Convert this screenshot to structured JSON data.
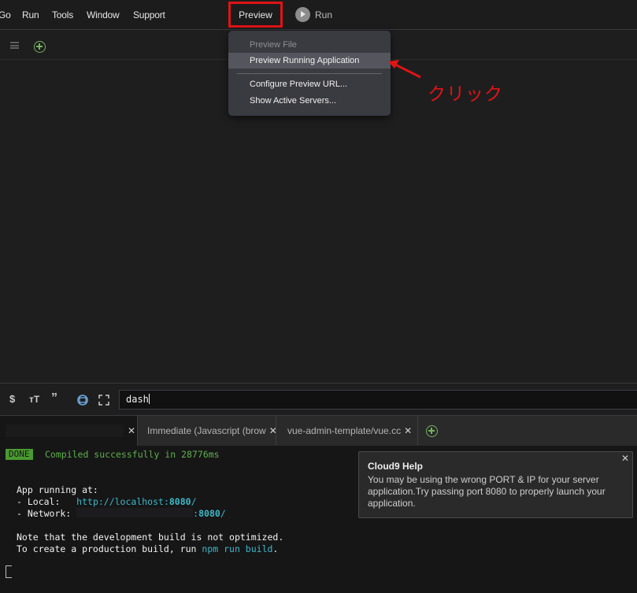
{
  "menubar": {
    "items": [
      "Go",
      "Run",
      "Tools",
      "Window",
      "Support"
    ],
    "preview_label": "Preview",
    "run_label": "Run"
  },
  "dropdown": {
    "items": [
      {
        "label": "Preview File",
        "state": "disabled"
      },
      {
        "label": "Preview Running Application",
        "state": "highlighted"
      },
      {
        "label": "Configure Preview URL...",
        "state": "normal"
      },
      {
        "label": "Show Active Servers...",
        "state": "normal"
      }
    ]
  },
  "annotation": {
    "label": "クリック",
    "color": "#e01414"
  },
  "terminal_toolbar": {
    "icons": [
      "dollar-icon",
      "text-size-icon",
      "quote-icon",
      "sync-icon",
      "fullscreen-icon"
    ],
    "input_value": "dash"
  },
  "terminal_tabs": [
    {
      "label": "",
      "redacted": true,
      "active": true
    },
    {
      "label": "Immediate (Javascript (brow",
      "active": false
    },
    {
      "label": "vue-admin-template/vue.cc",
      "active": false
    }
  ],
  "terminal": {
    "done_badge": "DONE",
    "compiled": "Compiled successfully in 28776ms",
    "running": "App running at:",
    "local_label": "- Local:   ",
    "local_url": "http://localhost:",
    "local_port": "8080",
    "trailing_slash": "/",
    "network_label": "- Network: ",
    "network_sep": ":",
    "network_port": "8080",
    "note1": "Note that the development build is not optimized.",
    "note2_pre": "To create a production build, run ",
    "note2_cmd": "npm run build",
    "note2_post": "."
  },
  "help_popup": {
    "title": "Cloud9 Help",
    "body": "You may be using the wrong PORT & IP for your server application.Try passing port 8080 to properly launch your application."
  },
  "colors": {
    "highlight_red": "#e01414",
    "done_green": "#4a9a2f",
    "url_cyan": "#3cb8c7",
    "plus_green": "#74b35e"
  }
}
